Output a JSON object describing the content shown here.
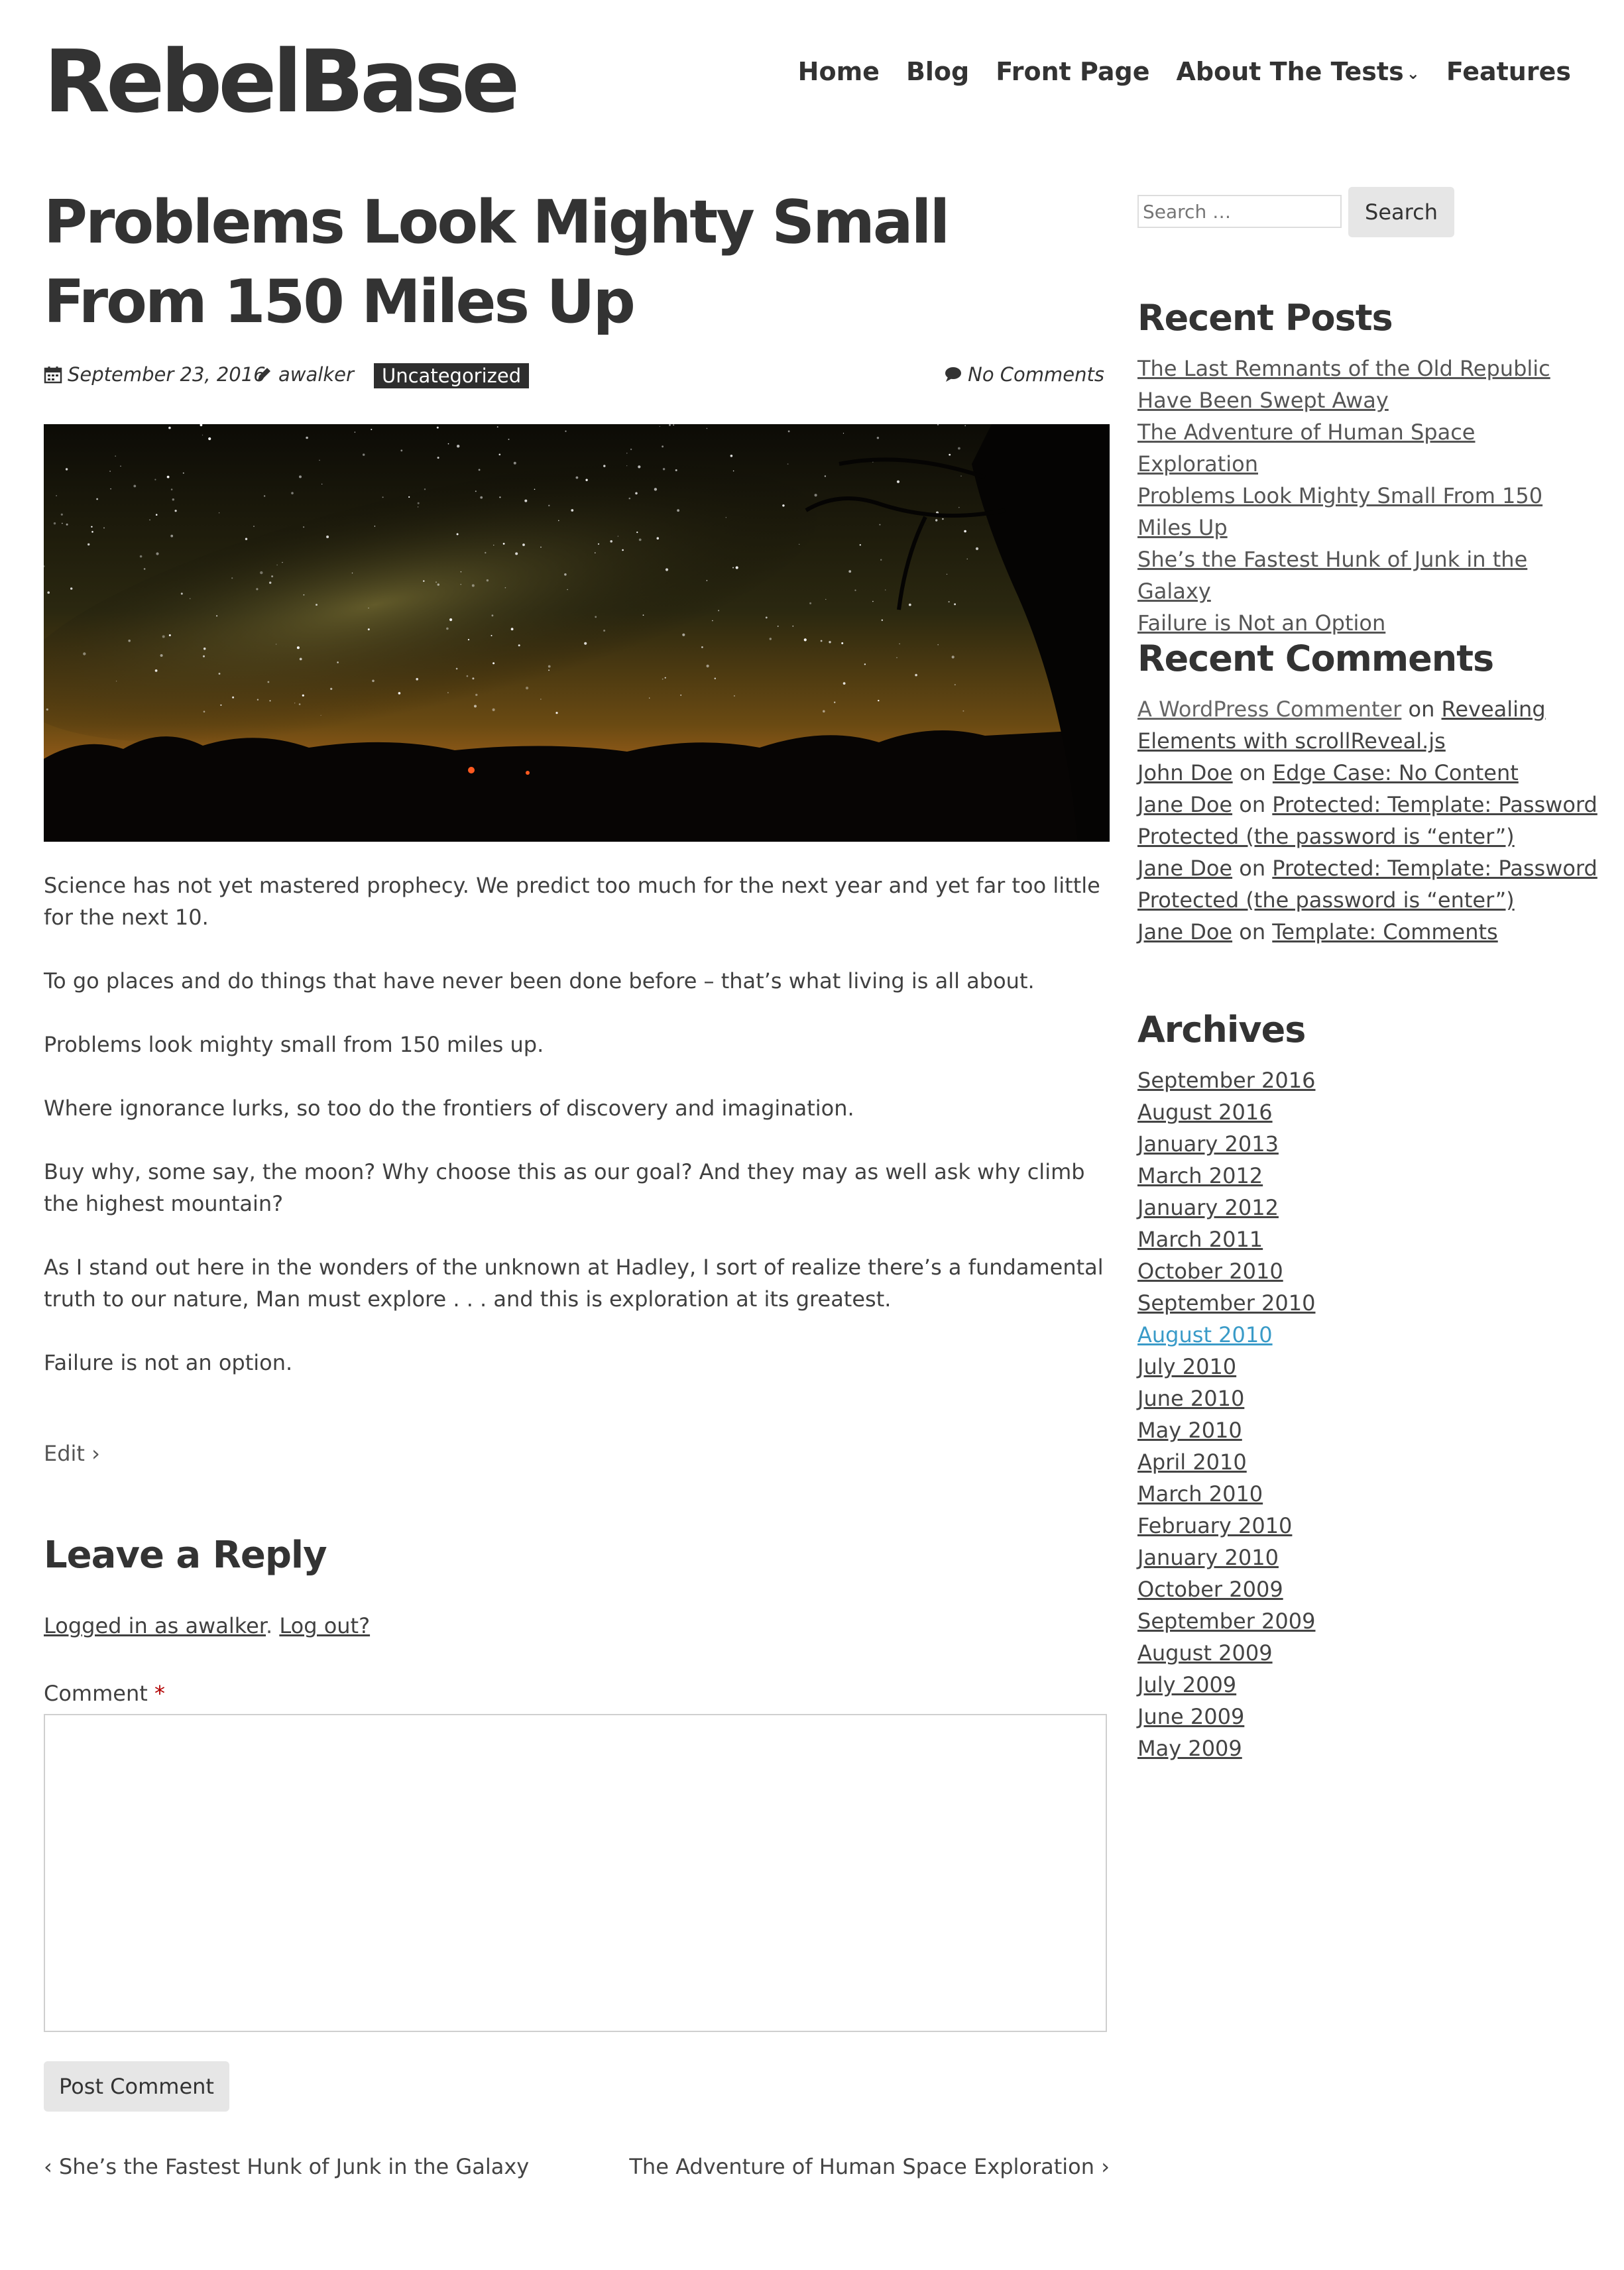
{
  "site": {
    "title": "RebelBase"
  },
  "nav": {
    "items": [
      "Home",
      "Blog",
      "Front Page",
      "About The Tests",
      "Features"
    ]
  },
  "post": {
    "title": "Problems Look Mighty Small From 150 Miles Up",
    "date": "September 23, 2016",
    "author": "awalker",
    "category": "Uncategorized",
    "comments": "No Comments",
    "paragraphs": [
      "Science has not yet mastered prophecy. We predict too much for the next year and yet far too little for the next 10.",
      "To go places and do things that have never been done before – that’s what living is all about.",
      "Problems look mighty small from 150 miles up.",
      "Where ignorance lurks, so too do the frontiers of discovery and imagination.",
      "Buy why, some say, the moon? Why choose this as our goal? And they may as well ask why climb the highest mountain?",
      "As I stand out here in the wonders of the unknown at Hadley, I sort of realize there’s a fundamental truth to our nature, Man must explore . . . and this is exploration at its greatest.",
      "Failure is not an option."
    ],
    "edit": "Edit"
  },
  "reply": {
    "title": "Leave a Reply",
    "logged_in": "Logged in as awalker",
    "period": ".",
    "logout": "Log out?",
    "comment_label": "Comment",
    "required_mark": "*",
    "submit": "Post Comment"
  },
  "post_nav": {
    "prev": "She’s the Fastest Hunk of Junk in the Galaxy",
    "next": "The Adventure of Human Space Exploration"
  },
  "sidebar": {
    "search_placeholder": "Search …",
    "search_button": "Search",
    "recent_posts_title": "Recent Posts",
    "recent_posts": [
      "The Last Remnants of the Old Republic Have Been Swept Away",
      "The Adventure of Human Space Exploration",
      "Problems Look Mighty Small From 150 Miles Up",
      "She’s the Fastest Hunk of Junk in the Galaxy",
      "Failure is Not an Option"
    ],
    "recent_comments_title": "Recent Comments",
    "recent_comments": [
      {
        "author": "A WordPress Commenter",
        "on": "on",
        "post": "Revealing Elements with scrollReveal.js"
      },
      {
        "author": "John Doe",
        "on": "on",
        "post": "Edge Case: No Content"
      },
      {
        "author": "Jane Doe",
        "on": "on",
        "post": "Protected: Template: Password Protected (the password is “enter”)"
      },
      {
        "author": "Jane Doe",
        "on": "on",
        "post": "Protected: Template: Password Protected (the password is “enter”)"
      },
      {
        "author": "Jane Doe",
        "on": "on",
        "post": "Template: Comments"
      }
    ],
    "archives_title": "Archives",
    "archives": [
      "September 2016",
      "August 2016",
      "January 2013",
      "March 2012",
      "January 2012",
      "March 2011",
      "October 2010",
      "September 2010",
      "August 2010",
      "July 2010",
      "June 2010",
      "May 2010",
      "April 2010",
      "March 2010",
      "February 2010",
      "January 2010",
      "October 2009",
      "September 2009",
      "August 2009",
      "July 2009",
      "June 2009",
      "May 2009"
    ],
    "archive_highlight_color": "#3a9bc8"
  }
}
